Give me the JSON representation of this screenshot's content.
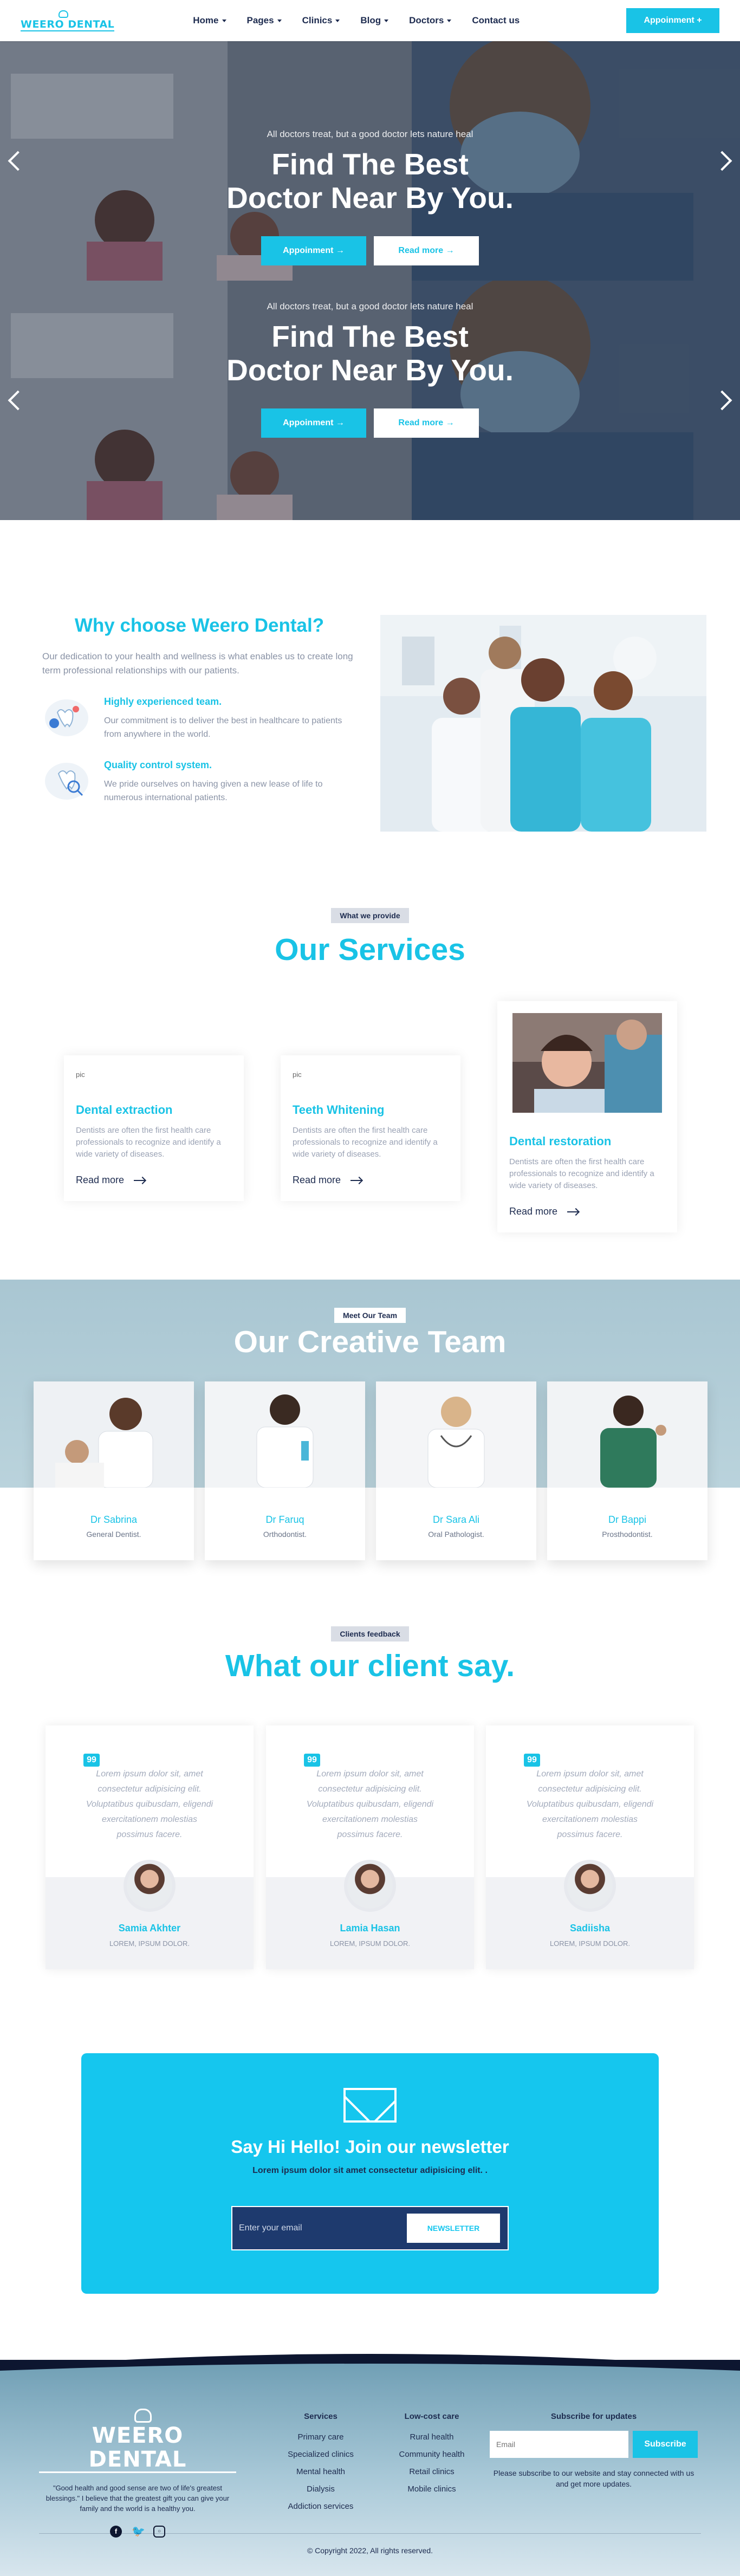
{
  "header": {
    "logo": "WEERO DENTAL",
    "nav": [
      {
        "label": "Home"
      },
      {
        "label": "Pages"
      },
      {
        "label": "Clinics"
      },
      {
        "label": "Blog"
      },
      {
        "label": "Doctors"
      },
      {
        "label": "Contact us"
      }
    ],
    "appointment_label": "Appoinment +"
  },
  "hero": {
    "subtitle": "All doctors treat, but a good doctor lets nature heal",
    "title_line1": "Find The Best",
    "title_line2": "Doctor Near By You.",
    "primary_btn": "Appoinment →",
    "secondary_btn": "Read more →"
  },
  "why": {
    "title": "Why choose Weero Dental?",
    "desc": "Our dedication to your health and wellness is what enables us to create long term professional relationships with our patients.",
    "features": [
      {
        "title": "Highly experienced team.",
        "desc": "Our commitment is to deliver the best in healthcare to patients from anywhere in the world."
      },
      {
        "title": "Quality control system.",
        "desc": "We pride ourselves on having given a new lease of life to numerous international patients."
      }
    ]
  },
  "services": {
    "tag": "What we provide",
    "title": "Our Services",
    "cards": [
      {
        "pic": "pic",
        "title": "Dental extraction",
        "desc": "Dentists are often the first health care professionals to recognize and identify a wide variety of diseases.",
        "more": "Read more"
      },
      {
        "pic": "pic",
        "title": "Teeth Whitening",
        "desc": "Dentists are often the first health care professionals to recognize and identify a wide variety of diseases.",
        "more": "Read more"
      },
      {
        "pic": "",
        "title": "Dental restoration",
        "desc": "Dentists are often the first health care professionals to recognize and identify a wide variety of diseases.",
        "more": "Read more"
      }
    ]
  },
  "team": {
    "tag": "Meet Our Team",
    "title": "Our Creative Team",
    "members": [
      {
        "name": "Dr Sabrina",
        "role": "General Dentist."
      },
      {
        "name": "Dr Faruq",
        "role": "Orthodontist."
      },
      {
        "name": "Dr Sara Ali",
        "role": "Oral Pathologist."
      },
      {
        "name": "Dr Bappi",
        "role": "Prosthodontist."
      }
    ]
  },
  "testimonials": {
    "tag": "Clients feedback",
    "title": "What our client say.",
    "items": [
      {
        "quote": "Lorem ipsum dolor sit, amet consectetur adipisicing elit. Voluptatibus quibusdam, eligendi exercitationem molestias possimus facere.",
        "name": "Samia Akhter",
        "role": "LOREM, IPSUM DOLOR."
      },
      {
        "quote": "Lorem ipsum dolor sit, amet consectetur adipisicing elit. Voluptatibus quibusdam, eligendi exercitationem molestias possimus facere.",
        "name": "Lamia Hasan",
        "role": "LOREM, IPSUM DOLOR."
      },
      {
        "quote": "Lorem ipsum dolor sit, amet consectetur adipisicing elit. Voluptatibus quibusdam, eligendi exercitationem molestias possimus facere.",
        "name": "Sadiisha",
        "role": "LOREM, IPSUM DOLOR."
      }
    ],
    "quote_mark": "99"
  },
  "newsletter": {
    "title": "Say Hi Hello! Join our newsletter",
    "sub": "Lorem ipsum dolor sit amet consectetur adipisicing elit. .",
    "placeholder": "Enter your email",
    "button": "NEWSLETTER"
  },
  "footer": {
    "logo": "WEERO DENTAL",
    "quote": "\"Good health and good sense are two of life's greatest blessings.\" I believe that the greatest gift you can give your family and the world is a healthy you.",
    "services_title": "Services",
    "services": [
      "Primary care",
      "Specialized clinics",
      "Mental health",
      "Dialysis",
      "Addiction services"
    ],
    "lowcost_title": "Low-cost care",
    "lowcost": [
      "Rural health",
      "Community health",
      "Retail clinics",
      "Mobile clinics"
    ],
    "subscribe_title": "Subscribe for updates",
    "subscribe_placeholder": "Email",
    "subscribe_button": "Subscribe",
    "subscribe_desc": "Please subscribe to our website and stay connected with us and get more updates.",
    "copyright": "© Copyright 2022, All rights reserved."
  },
  "colors": {
    "accent": "#19c3e6",
    "navy": "#1d2b4f",
    "newsletter_bg": "#15c6ee"
  }
}
